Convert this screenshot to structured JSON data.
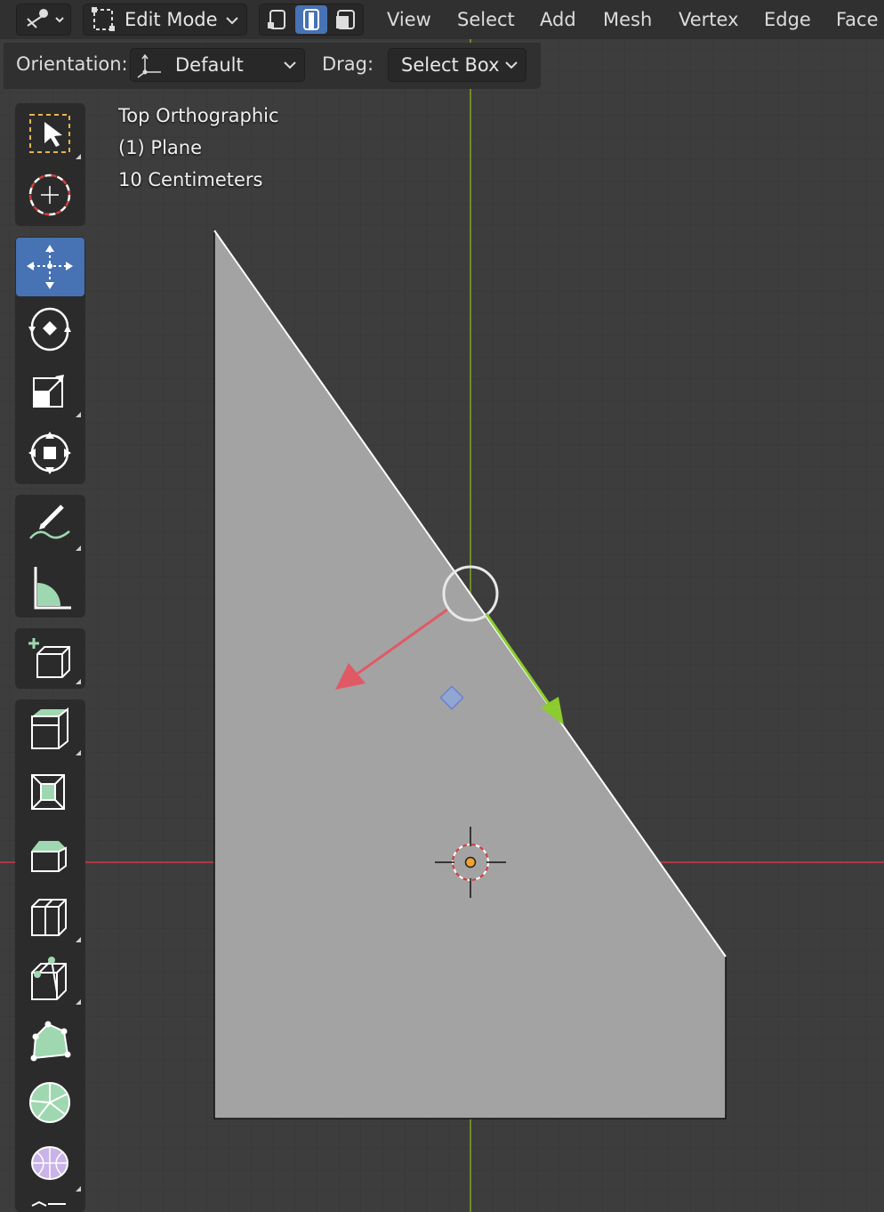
{
  "header": {
    "mode": "Edit Mode",
    "menus": [
      "View",
      "Select",
      "Add",
      "Mesh",
      "Vertex",
      "Edge",
      "Face"
    ]
  },
  "tool_settings": {
    "orientation_label": "Orientation:",
    "orientation_value": "Default",
    "drag_label": "Drag:",
    "drag_value": "Select Box"
  },
  "overlay": {
    "view_name": "Top Orthographic",
    "object_name": "(1) Plane",
    "scale": "10 Centimeters"
  },
  "toolbar": {
    "tools": [
      "select-box",
      "cursor",
      "move",
      "rotate",
      "scale",
      "transform",
      "annotate",
      "measure",
      "add-cube",
      "extrude-region",
      "inset-faces",
      "bevel",
      "loop-cut",
      "knife",
      "poly-build",
      "spin",
      "smooth"
    ],
    "active": "move"
  },
  "colors": {
    "grid_bg": "#3d3d3d",
    "face": "#a3a3a3",
    "x_axis": "#a83a47",
    "y_axis": "#6e8c25",
    "gizmo_x": "#e05a66",
    "gizmo_y": "#8ccc2e",
    "active_tool": "#4772b3"
  }
}
